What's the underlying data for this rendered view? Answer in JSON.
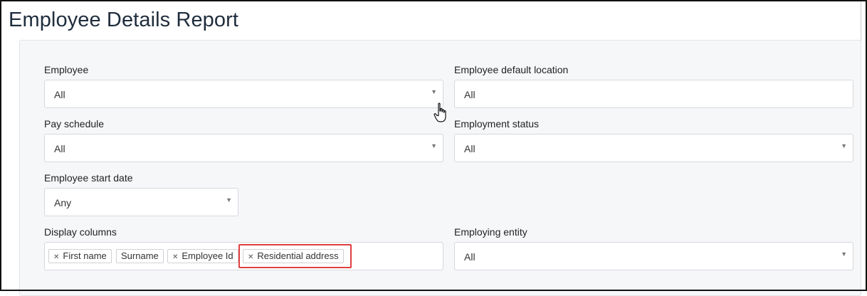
{
  "page": {
    "title": "Employee Details Report"
  },
  "filters": {
    "employee": {
      "label": "Employee",
      "value": "All"
    },
    "employee_default_location": {
      "label": "Employee default location",
      "value": "All"
    },
    "pay_schedule": {
      "label": "Pay schedule",
      "value": "All"
    },
    "employment_status": {
      "label": "Employment status",
      "value": "All"
    },
    "employee_start_date": {
      "label": "Employee start date",
      "value": "Any"
    },
    "display_columns": {
      "label": "Display columns",
      "tags": [
        {
          "label": "First name",
          "removable": true
        },
        {
          "label": "Surname",
          "removable": false
        },
        {
          "label": "Employee Id",
          "removable": true
        },
        {
          "label": "Residential address",
          "removable": true
        }
      ]
    },
    "employing_entity": {
      "label": "Employing entity",
      "value": "All"
    }
  },
  "icons": {
    "caret": "caret-down-icon",
    "remove": "remove-x-icon",
    "cursor": "hand-pointer-icon"
  },
  "colors": {
    "highlight": "#e04040",
    "title": "#1f2d3d",
    "panel_bg": "#f6f7f9"
  }
}
